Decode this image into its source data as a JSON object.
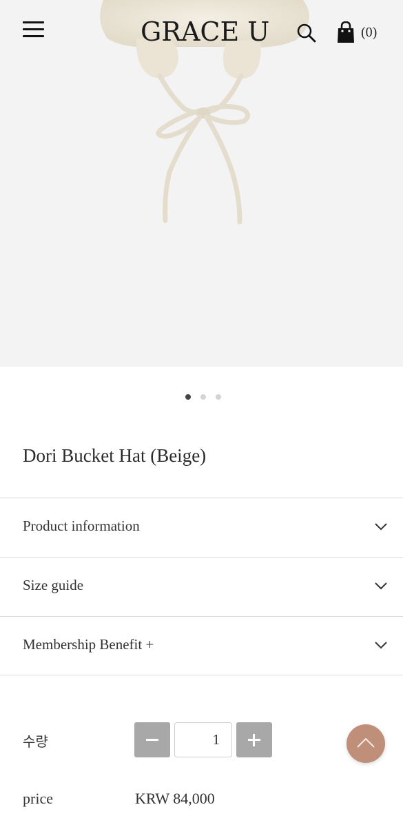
{
  "header": {
    "logo": "GRACE U",
    "cart_count": "(0)",
    "icons": [
      "menu-icon",
      "search-icon",
      "shopping-bag-icon"
    ]
  },
  "carousel": {
    "slide_count": 3,
    "active_index": 0
  },
  "product": {
    "title": "Dori Bucket Hat (Beige)"
  },
  "accordion": [
    {
      "label": "Product information"
    },
    {
      "label": "Size guide"
    },
    {
      "label": "Membership Benefit +"
    }
  ],
  "purchase": {
    "quantity_label": "수량",
    "quantity_value": "1",
    "price_label": "price",
    "price_value": "KRW 84,000"
  },
  "colors": {
    "hero_background": "#f3f3f3",
    "hat_beige": "#ece6d8",
    "stepper_button": "#a8a8a8",
    "scroll_top_button": "#c08f7a"
  }
}
